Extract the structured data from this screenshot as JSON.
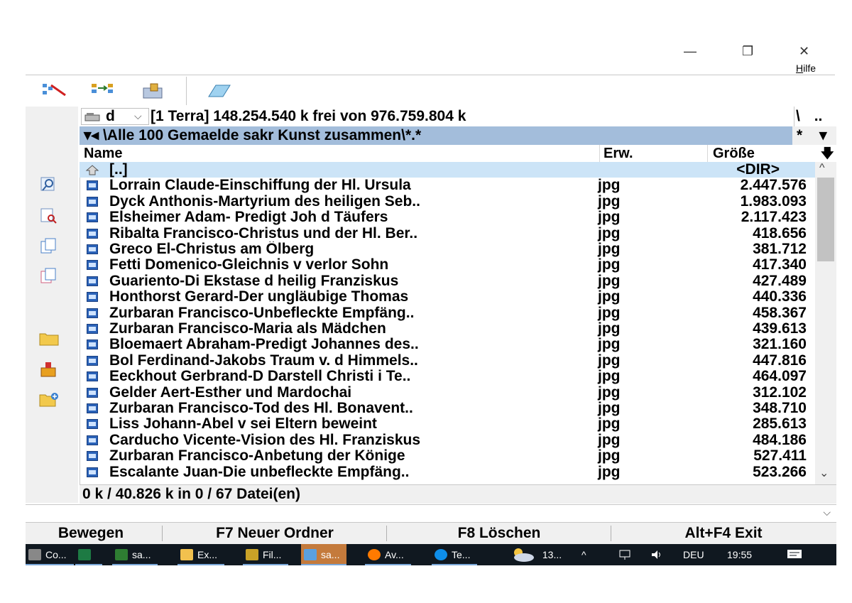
{
  "window": {
    "minimize_glyph": "—",
    "restore_glyph": "❐",
    "close_glyph": "✕",
    "menu_help_prefix": "",
    "menu_help_underlined": "H",
    "menu_help_rest": "ilfe"
  },
  "drive_bar": {
    "drive_letter": "d",
    "dropdown_glyph": "⌵",
    "info": "[1 Terra]  148.254.540 k frei von 976.759.804 k",
    "root_button": "\\",
    "parent_button": ".."
  },
  "path_bar": {
    "history_glyph": "▾◂",
    "path": "\\Alle 100 Gemaelde sakr Kunst zusammen\\*.*",
    "filter_glyph": "*",
    "menu_glyph": "▾"
  },
  "columns": {
    "name": "Name",
    "ext": "Erw.",
    "size": "Größe",
    "sort_glyph": "🡇"
  },
  "files": [
    {
      "name": "[..]",
      "ext": "",
      "size": "<DIR>",
      "parent": true
    },
    {
      "name": "Lorrain Claude-Einschiffung der Hl. Ursula",
      "ext": "jpg",
      "size": "2.447.576"
    },
    {
      "name": "Dyck Anthonis-Martyrium des heiligen Seb..",
      "ext": "jpg",
      "size": "1.983.093"
    },
    {
      "name": "Elsheimer Adam- Predigt Joh d Täufers",
      "ext": "jpg",
      "size": "2.117.423"
    },
    {
      "name": "Ribalta Francisco-Christus und der Hl. Ber..",
      "ext": "jpg",
      "size": "418.656"
    },
    {
      "name": "Greco El-Christus am Ölberg",
      "ext": "jpg",
      "size": "381.712"
    },
    {
      "name": "Fetti Domenico-Gleichnis v verlor Sohn",
      "ext": "jpg",
      "size": "417.340"
    },
    {
      "name": "Guariento-Di Ekstase d heilig Franziskus",
      "ext": "jpg",
      "size": "427.489"
    },
    {
      "name": "Honthorst Gerard-Der ungläubige Thomas",
      "ext": "jpg",
      "size": "440.336"
    },
    {
      "name": "Zurbaran Francisco-Unbefleckte Empfäng..",
      "ext": "jpg",
      "size": "458.367"
    },
    {
      "name": "Zurbaran Francisco-Maria als Mädchen",
      "ext": "jpg",
      "size": "439.613"
    },
    {
      "name": "Bloemaert Abraham-Predigt Johannes des..",
      "ext": "jpg",
      "size": "321.160"
    },
    {
      "name": "Bol Ferdinand-Jakobs Traum v. d Himmels..",
      "ext": "jpg",
      "size": "447.816"
    },
    {
      "name": "Eeckhout Gerbrand-D Darstell Christi i Te..",
      "ext": "jpg",
      "size": "464.097"
    },
    {
      "name": "Gelder Aert-Esther und Mardochai",
      "ext": "jpg",
      "size": "312.102"
    },
    {
      "name": "Zurbaran Francisco-Tod des Hl. Bonavent..",
      "ext": "jpg",
      "size": "348.710"
    },
    {
      "name": "Liss Johann-Abel v sei Eltern beweint",
      "ext": "jpg",
      "size": "285.613"
    },
    {
      "name": "Carducho Vicente-Vision des Hl. Franziskus",
      "ext": "jpg",
      "size": "484.186"
    },
    {
      "name": "Zurbaran Francisco-Anbetung der Könige",
      "ext": "jpg",
      "size": "527.411"
    },
    {
      "name": "Escalante Juan-Die unbefleckte Empfäng..",
      "ext": "jpg",
      "size": "523.266"
    }
  ],
  "scrollbar": {
    "up_glyph": "^",
    "down_glyph": "⌄"
  },
  "status": "0 k / 40.826 k in 0 / 67 Datei(en)",
  "cmdline": {
    "dropdown_glyph": "⌵"
  },
  "fkeys": [
    "Bewegen",
    "F7 Neuer Ordner",
    "F8 Löschen",
    "Alt+F4 Exit"
  ],
  "taskbar": {
    "tasks": [
      {
        "label": "Co...",
        "icon": "app-icon",
        "color": "#888888"
      },
      {
        "label": "",
        "icon": "excel-icon",
        "color": "#1d7a43"
      },
      {
        "label": "sa...",
        "icon": "project-icon",
        "color": "#2e7d32"
      },
      {
        "label": "Ex...",
        "icon": "explorer-icon",
        "color": "#f2c14e"
      },
      {
        "label": "Fil...",
        "icon": "filezilla-icon",
        "color": "#c9a227"
      },
      {
        "label": "sa...",
        "icon": "image-viewer-icon",
        "color": "#5aa0e0"
      },
      {
        "label": "Av...",
        "icon": "avast-icon",
        "color": "#ff7a00"
      },
      {
        "label": "Te...",
        "icon": "teamviewer-icon",
        "color": "#0e8ee9"
      }
    ],
    "weather": "13...",
    "tray_up": "^",
    "language": "DEU",
    "time": "19:55"
  }
}
